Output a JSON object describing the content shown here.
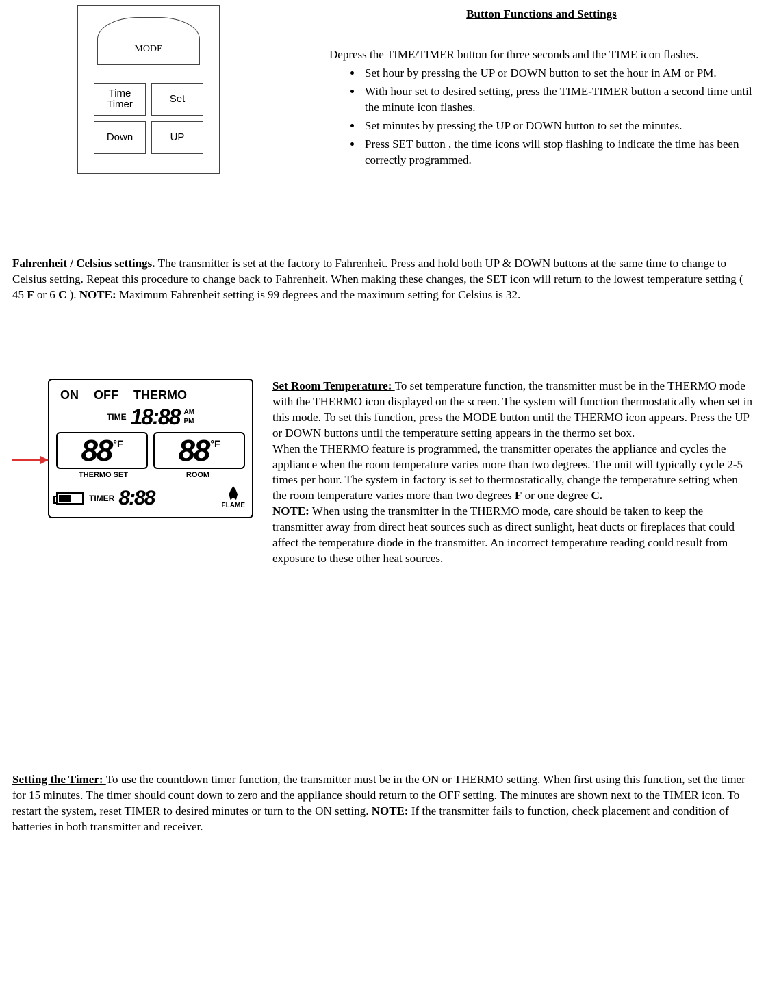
{
  "header": {
    "title": "Button Functions and Settings"
  },
  "remote": {
    "mode": "MODE",
    "time1": "Time",
    "time2": "Timer",
    "set": "Set",
    "down": "Down",
    "up": "UP"
  },
  "intro_para": "Depress the TIME/TIMER button for three seconds and the TIME icon flashes.",
  "bullets": [
    "Set hour by pressing the UP or DOWN button to set the hour in AM or PM.",
    "With hour set to desired setting, press the TIME-TIMER button a second time until the minute icon flashes.",
    "Set minutes by pressing the UP or DOWN button to set the minutes.",
    "Press SET button ,  the time icons will stop flashing to indicate the time has been correctly programmed."
  ],
  "fc": {
    "heading": "Fahrenheit / Celsius settings.  ",
    "body_a": "The transmitter is set at the factory to Fahrenheit.  Press and hold both UP & DOWN buttons at the same time to change to Celsius setting.  Repeat this procedure to change back to Fahrenheit.  When making these changes, the SET icon will return to the lowest temperature setting ( 45 ",
    "f": "F",
    "body_b": " or 6 ",
    "c": "C",
    "body_c": " ).  ",
    "note_lbl": "NOTE:",
    "body_d": "  Maximum Fahrenheit setting is 99 degrees and the maximum setting for Celsius is 32."
  },
  "lcd": {
    "on": "ON",
    "off": "OFF",
    "thermo": "THERMO",
    "time_lbl": "TIME",
    "time_val": "18:88",
    "am": "AM",
    "pm": "PM",
    "temp_val": "88",
    "degf": "°F",
    "thermo_set": "THERMO SET",
    "room": "ROOM",
    "timer_lbl": "TIMER",
    "timer_val": "8:88",
    "flame": "FLAME"
  },
  "srt": {
    "heading": "Set Room Temperature:  ",
    "p1": "To set temperature function, the transmitter must be in the THERMO mode with the THERMO icon displayed on the screen.  The system will function thermostatically when set in this mode.  To set this function, press the MODE button until the THERMO icon appears.  Press the UP or DOWN buttons until the temperature setting appears in the thermo set box.",
    "p2a": "When the THERMO feature is programmed, the transmitter operates the appliance and cycles the appliance when the room temperature varies more than two degrees.  The unit will typically cycle 2-5 times per hour.  The system in factory is set to thermostatically, change the temperature setting when the room temperature varies more than two degrees ",
    "p2_f": "F",
    "p2b": " or one degree ",
    "p2_c": "C.",
    "note_lbl": "NOTE:",
    "p3": " When using the transmitter in the THERMO mode, care should be taken to keep the transmitter away from direct heat sources such as direct sunlight, heat ducts or fireplaces that could affect the temperature diode in the transmitter.  An incorrect temperature reading could result from exposure to these other heat sources."
  },
  "timer": {
    "heading": "Setting the Timer:  ",
    "p1a": "To use the countdown timer function, the transmitter must be in the ON or THERMO setting.  When first using this function, set the timer for 15 minutes.  The timer should count down to zero and the appliance should return to the OFF setting.    The minutes are shown next to the TIMER icon.  To restart the system, reset TIMER to desired minutes or turn to the ON setting.  ",
    "note_lbl": "NOTE:",
    "p1b": " If the transmitter fails to function, check placement and condition of batteries in both transmitter and receiver."
  }
}
